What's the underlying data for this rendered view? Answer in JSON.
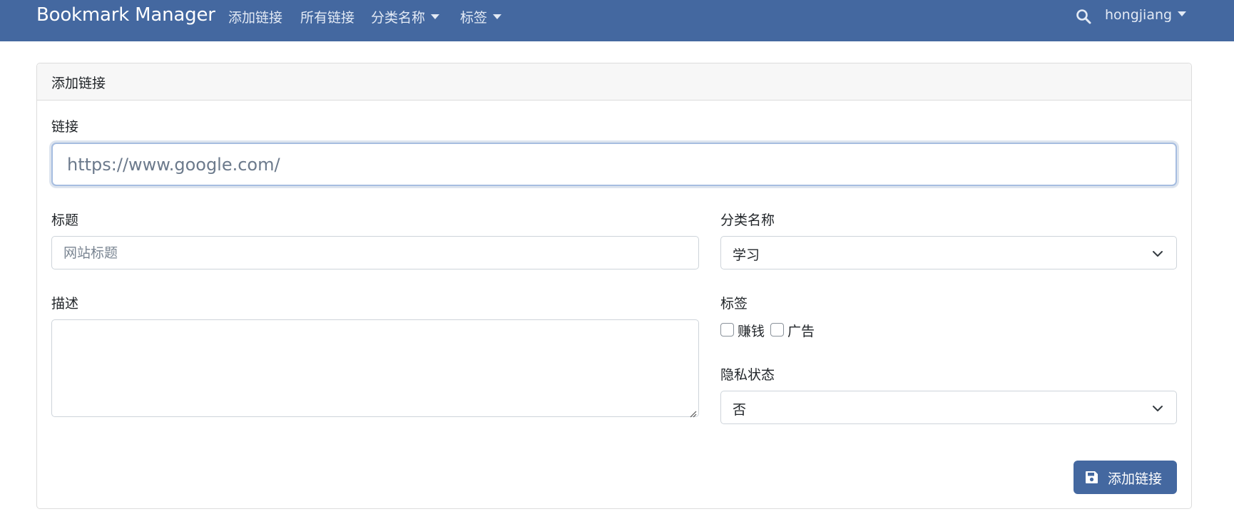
{
  "navbar": {
    "brand": "Bookmark Manager",
    "links": {
      "add_link": "添加链接",
      "all_links": "所有链接",
      "categories": "分类名称",
      "tags": "标签"
    },
    "username": "hongjiang",
    "search_icon": "search-icon",
    "background_color": "#4468a0"
  },
  "card": {
    "title": "添加链接",
    "url": {
      "label": "链接",
      "value": "",
      "placeholder": "https://www.google.com/"
    },
    "title_field": {
      "label": "标题",
      "value": "",
      "placeholder": "网站标题"
    },
    "category": {
      "label": "分类名称",
      "selected": "学习"
    },
    "description": {
      "label": "描述",
      "value": ""
    },
    "tags": {
      "label": "标签",
      "options": [
        {
          "label": "赚钱",
          "checked": false
        },
        {
          "label": "广告",
          "checked": false
        }
      ]
    },
    "privacy": {
      "label": "隐私状态",
      "selected": "否"
    },
    "submit": {
      "label": "添加链接",
      "icon": "save-icon",
      "color": "#4468a0"
    }
  }
}
